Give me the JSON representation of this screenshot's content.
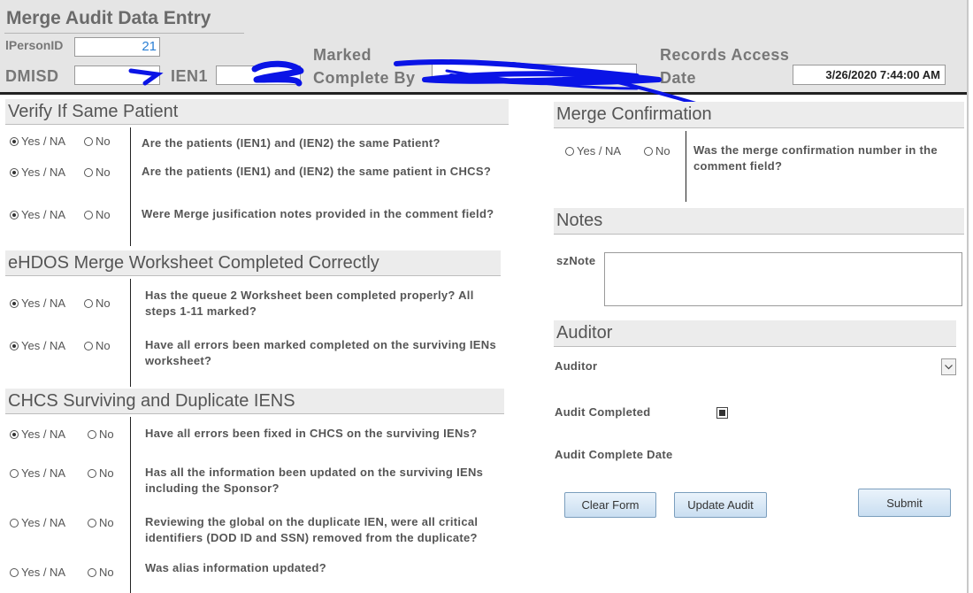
{
  "form": {
    "title": "Merge Audit Data Entry",
    "person_id_label": "lPersonID",
    "person_id_value": "21",
    "dmisd_label": "DMISD",
    "ien1_label": "IEN1",
    "marked_complete_label_1": "Marked",
    "marked_complete_label_2": "Complete By",
    "records_access_label_1": "Records Access",
    "records_access_label_2": "Date",
    "records_access_value": "3/26/2020 7:44:00 AM"
  },
  "radio": {
    "yes_label": "Yes / NA",
    "no_label": "No"
  },
  "sections": {
    "verify": {
      "title": "Verify If Same Patient",
      "questions": [
        {
          "text": "Are the patients (IEN1) and (IEN2) the same Patient?",
          "selected": "yes"
        },
        {
          "text": "Are the patients (IEN1) and (IEN2) the same patient in CHCS?",
          "selected": "yes"
        },
        {
          "text": "Were Merge jusification notes provided in the comment field?",
          "selected": "yes"
        }
      ]
    },
    "worksheet": {
      "title": "eHDOS Merge Worksheet Completed Correctly",
      "questions": [
        {
          "text": "Has the queue 2 Worksheet been completed properly? All steps 1-11 marked?",
          "selected": "yes"
        },
        {
          "text": "Have all errors been marked completed on the surviving IENs worksheet?",
          "selected": "yes"
        }
      ]
    },
    "chcs": {
      "title": "CHCS Surviving and Duplicate IENS",
      "questions": [
        {
          "text": "Have all errors been fixed in CHCS on the surviving IENs?",
          "selected": "yes"
        },
        {
          "text": "Has all the information been updated on the surviving IENs including the Sponsor?",
          "selected": "none"
        },
        {
          "text": "Reviewing the global on the duplicate IEN, were all critical identifiers (DOD ID and SSN) removed from the duplicate?",
          "selected": "none"
        },
        {
          "text": "Was alias information updated?",
          "selected": "none"
        }
      ]
    },
    "merge_confirmation": {
      "title": "Merge Confirmation",
      "question": "Was the merge confirmation number in the comment field?",
      "selected": "none"
    },
    "notes": {
      "title": "Notes",
      "label": "szNote"
    },
    "auditor": {
      "title": "Auditor",
      "auditor_label": "Auditor",
      "audit_completed_label": "Audit Completed",
      "audit_complete_date_label": "Audit Complete Date"
    }
  },
  "buttons": {
    "clear": "Clear Form",
    "update": "Update Audit",
    "submit": "Submit"
  }
}
